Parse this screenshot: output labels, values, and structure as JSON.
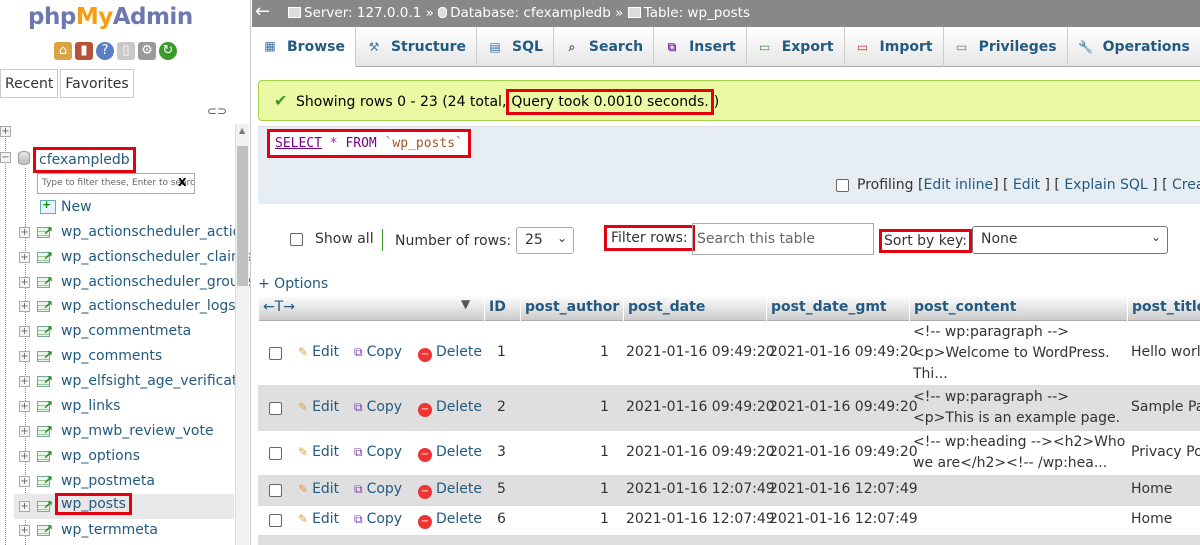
{
  "nav": {
    "logo_php": "php",
    "logo_my": "My",
    "logo_admin": "Admin",
    "tab_recent": "Recent",
    "tab_favorites": "Favorites",
    "database": "cfexampledb",
    "filter_placeholder": "Type to filter these, Enter to search",
    "filter_clear": "X",
    "new_label": "New",
    "tables": [
      "wp_actionscheduler_actions",
      "wp_actionscheduler_claims",
      "wp_actionscheduler_groups",
      "wp_actionscheduler_logs",
      "wp_commentmeta",
      "wp_comments",
      "wp_elfsight_age_verification",
      "wp_links",
      "wp_mwb_review_vote",
      "wp_options",
      "wp_postmeta",
      "wp_posts",
      "wp_termmeta"
    ],
    "selected_table": "wp_posts"
  },
  "breadcrumb": {
    "server": "Server: 127.0.0.1",
    "database": "Database: cfexampledb",
    "table": "Table: wp_posts",
    "sep": "»"
  },
  "tabs": [
    {
      "label": "Browse",
      "icon": "browse-icon"
    },
    {
      "label": "Structure",
      "icon": "structure-icon"
    },
    {
      "label": "SQL",
      "icon": "sql-icon"
    },
    {
      "label": "Search",
      "icon": "search-icon"
    },
    {
      "label": "Insert",
      "icon": "insert-icon"
    },
    {
      "label": "Export",
      "icon": "export-icon"
    },
    {
      "label": "Import",
      "icon": "import-icon"
    },
    {
      "label": "Privileges",
      "icon": "privileges-icon"
    },
    {
      "label": "Operations",
      "icon": "operations-icon"
    }
  ],
  "result": {
    "message": "Showing rows 0 - 23 (24 total,",
    "query_time": "Query took 0.0010 seconds.",
    "close": ")"
  },
  "sql": {
    "select": "SELECT",
    "star": "*",
    "from": "FROM",
    "table": "`wp_posts`",
    "profiling": "Profiling",
    "edit_inline": "Edit inline",
    "edit": "Edit",
    "explain": "Explain SQL",
    "create_php": "Create PHP code"
  },
  "controls": {
    "show_all": "Show all",
    "number_of_rows_label": "Number of rows:",
    "number_of_rows_value": "25",
    "filter_rows_label": "Filter rows:",
    "search_placeholder": "Search this table",
    "sort_by_key_label": "Sort by key:",
    "sort_by_key_value": "None",
    "options_link": "+ Options"
  },
  "grid": {
    "arrows": "←T→",
    "columns": [
      "ID",
      "post_author",
      "post_date",
      "post_date_gmt",
      "post_content",
      "post_title"
    ],
    "action_edit": "Edit",
    "action_copy": "Copy",
    "action_delete": "Delete",
    "rows": [
      {
        "id": "1",
        "author": "1",
        "date": "2021-01-16 09:49:20",
        "date_gmt": "2021-01-16 09:49:20",
        "content": "<!-- wp:paragraph --> <p>Welcome to WordPress. Thi...",
        "title": "Hello world"
      },
      {
        "id": "2",
        "author": "1",
        "date": "2021-01-16 09:49:20",
        "date_gmt": "2021-01-16 09:49:20",
        "content": "<!-- wp:paragraph --> <p>This is an example page. ...",
        "title": "Sample Pa"
      },
      {
        "id": "3",
        "author": "1",
        "date": "2021-01-16 09:49:20",
        "date_gmt": "2021-01-16 09:49:20",
        "content": "<!-- wp:heading --><h2>Who we are</h2><!-- /wp:hea...",
        "title": "Privacy Po"
      },
      {
        "id": "5",
        "author": "1",
        "date": "2021-01-16 12:07:49",
        "date_gmt": "2021-01-16 12:07:49",
        "content": "",
        "title": "Home"
      },
      {
        "id": "6",
        "author": "1",
        "date": "2021-01-16 12:07:49",
        "date_gmt": "2021-01-16 12:07:49",
        "content": "",
        "title": "Home"
      }
    ]
  },
  "colors": {
    "link": "#235a81",
    "highlight_border": "#e3000f",
    "success_bg": "#ebf8a4",
    "topbar": "#888888"
  }
}
